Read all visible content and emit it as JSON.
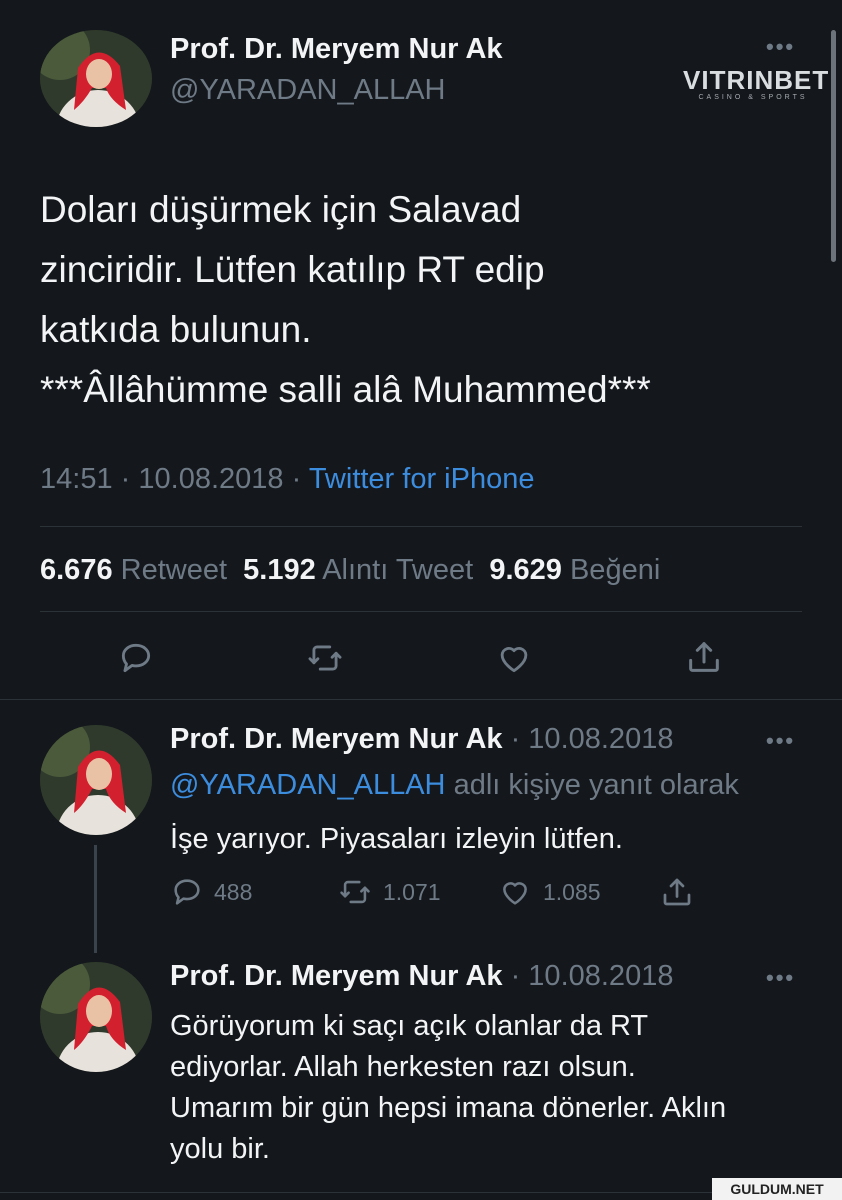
{
  "main_tweet": {
    "author_name": "Prof. Dr. Meryem Nur Ak",
    "handle": "@YARADAN_ALLAH",
    "text_lines": [
      "Doları düşürmek için Salavad",
      "zinciridir.  Lütfen katılıp RT edip",
      "katkıda bulunun.",
      "***Âllâhümme salli alâ Muhammed***"
    ],
    "time": "14:51",
    "date": "10.08.2018",
    "separator": "·",
    "source": "Twitter for iPhone",
    "stats": {
      "retweets": "6.676",
      "retweets_label": "Retweet",
      "quotes": "5.192",
      "quotes_label": "Alıntı Tweet",
      "likes": "9.629",
      "likes_label": "Beğeni"
    }
  },
  "watermark": {
    "brand": "VITRINBET",
    "tagline": "CASINO & SPORTS"
  },
  "replies": [
    {
      "author_name": "Prof. Dr. Meryem Nur Ak",
      "date": "· 10.08.2018",
      "reply_to_handle": "@YARADAN_ALLAH",
      "reply_to_suffix": "adlı kişiye yanıt olarak",
      "text_lines": [
        "İşe yarıyor. Piyasaları izleyin lütfen."
      ],
      "replies_count": "488",
      "retweets_count": "1.071",
      "likes_count": "1.085"
    },
    {
      "author_name": "Prof. Dr. Meryem Nur Ak",
      "date": "· 10.08.2018",
      "text_lines": [
        "Görüyorum ki saçı açık olanlar da RT",
        "ediyorlar. Allah herkesten razı olsun.",
        "Umarım bir gün hepsi imana dönerler. Aklın",
        "yolu bir."
      ]
    }
  ],
  "site_watermark": "GULDUM.NET",
  "more_glyph": "•••",
  "icons": {
    "reply": "speech-bubble-icon",
    "retweet": "retweet-arrows-icon",
    "like": "heart-icon",
    "share": "share-upload-icon"
  },
  "colors": {
    "background": "#14171c",
    "link": "#3d8ddf",
    "muted": "#6e7a86",
    "avatar_scarf": "#d2202e"
  }
}
